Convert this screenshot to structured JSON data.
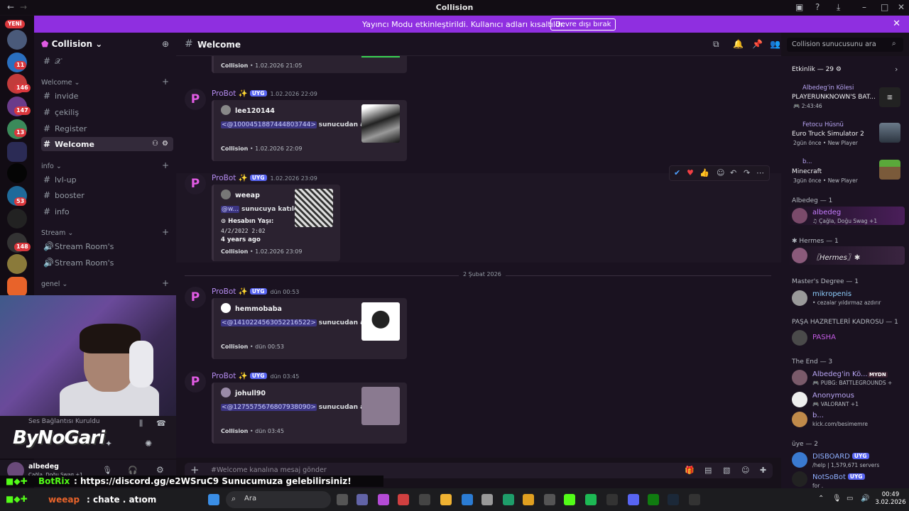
{
  "window": {
    "title": "Collision"
  },
  "notice": {
    "message": "Yayıncı Modu etkinleştirildi. Kullanıcı adları kısaltıldı.",
    "button": "Devre dışı bırak"
  },
  "rail": {
    "new_label": "YENİ",
    "badges": [
      "11",
      "146",
      "147",
      "13",
      "53",
      "148"
    ]
  },
  "server": {
    "name": "Collision"
  },
  "channels": {
    "top": "𝒳",
    "cat_welcome": "Welcome",
    "cat_info": "info",
    "cat_stream": "Stream",
    "cat_genel": "genel",
    "items": [
      "invide",
      "çekiliş",
      "Register",
      "Welcome",
      "lvl-up",
      "booster",
      "info",
      "Stream Room's",
      "Stream Room's"
    ]
  },
  "voice": {
    "status": "Ses Bağlantısı Kuruldu",
    "overlay_name": "ByNoGari"
  },
  "user": {
    "name": "albedeg",
    "sub": "Çağla, Doğu Swag +1"
  },
  "header": {
    "channel": "Welcome",
    "search_placeholder": "Collision sunucusunu ara"
  },
  "messages": [
    {
      "foot_server": "Collision",
      "foot_time": "1.02.2026 21:05"
    },
    {
      "author": "ProBot ✨",
      "tag": "UYG",
      "time": "1.02.2026 22:09",
      "embed_author": "lee120144",
      "mention": "<@1000451887444803744>",
      "text": "sunucudan ayrıldı.",
      "foot_server": "Collision",
      "foot_time": "1.02.2026 22:09"
    },
    {
      "author": "ProBot ✨",
      "tag": "UYG",
      "time": "1.02.2026 23:09",
      "embed_author": "weeap",
      "mention": "@w...",
      "text": "sunucuya katıldı.",
      "field_name": "⊙ Hesabın Yaşı:",
      "field_value": "4/2/2022 2:02",
      "field_rel": "4 years ago",
      "foot_server": "Collision",
      "foot_time": "1.02.2026 23:09"
    },
    {
      "author": "ProBot ✨",
      "tag": "UYG",
      "time": "dün 00:53",
      "embed_author": "hemmobaba",
      "mention": "<@1410224563052216522>",
      "text": "sunucudan ayrıldı.",
      "foot_server": "Collision",
      "foot_time": "dün 00:53"
    },
    {
      "author": "ProBot ✨",
      "tag": "UYG",
      "time": "dün 03:45",
      "embed_author": "johull90",
      "mention": "<@1275575676807938090>",
      "text": "sunucudan ayrıldı.",
      "foot_server": "Collision",
      "foot_time": "dün 03:45"
    }
  ],
  "divider": "2 Şubat 2026",
  "composer": {
    "placeholder": "#Welcome kanalına mesaj gönder"
  },
  "members": {
    "activity_header": "Etkinlik — 29",
    "activities": [
      {
        "user": "Albedeg'in Kölesi",
        "title": "PLAYERUNKNOWN'S BAT...",
        "meta": "🎮 2:43:46"
      },
      {
        "user": "Fetocu Hüsnü",
        "title": "Euro Truck Simulator 2",
        "meta": "2gün önce • New Player"
      },
      {
        "user": "b...",
        "title": "Minecraft",
        "meta": "3gün önce • New Player"
      }
    ],
    "groups": [
      {
        "label": "Albedeg — 1",
        "members": [
          {
            "name": "albedeg",
            "sub": "♫ Çağla, Doğu Swag +1",
            "color": "#c77dff"
          }
        ]
      },
      {
        "label": "✱ Hermes — 1",
        "members": [
          {
            "name": "〖Hermes〗✱",
            "sub": "",
            "color": "#e6e6e6"
          }
        ]
      },
      {
        "label": "Master's Degree — 1",
        "members": [
          {
            "name": "mikropenis",
            "sub": "• cezalar yıldırmaz azdırır",
            "color": "#8fd0ff"
          }
        ]
      },
      {
        "label": "PAŞA HAZRETLERİ KADROSU — 1",
        "members": [
          {
            "name": "PASHA",
            "sub": "",
            "color": "#c35be3"
          }
        ]
      },
      {
        "label": "The End — 3",
        "members": [
          {
            "name": "Albedeg'in Kö...",
            "sub": "🎮 PUBG: BATTLEGROUNDS +",
            "color": "#b9a6f5",
            "badge": "MYDN"
          },
          {
            "name": "Anonymous",
            "sub": "🎮 VALORANT +1",
            "color": "#b9a6f5"
          },
          {
            "name": "b...",
            "sub": "kick.com/besimemre",
            "color": "#b9a6f5"
          }
        ]
      },
      {
        "label": "üye — 2",
        "members": [
          {
            "name": "DISBOARD",
            "sub": "/help | 1,579,671 servers",
            "color": "#8fb0ff",
            "tag": "UYG"
          },
          {
            "name": "NotSoBot",
            "sub": "for .",
            "color": "#8fb0ff",
            "tag": "UYG"
          }
        ]
      }
    ]
  },
  "overlay": {
    "botrix_name": "BotRix",
    "botrix_text": ": https://discord.gg/e2WSruC9 Sunucumuza gelebilirsiniz!",
    "chat_user": "weeap",
    "chat_text": ": chate . atıom"
  },
  "taskbar": {
    "search": "Ara",
    "time": "00:49",
    "date": "3.02.2026"
  }
}
